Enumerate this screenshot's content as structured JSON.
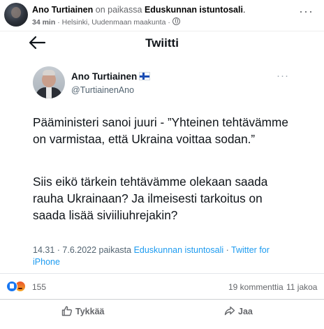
{
  "post": {
    "author": "Ano Turtiainen",
    "connector": "on paikassa",
    "place": "Eduskunnan istuntosali",
    "period": ".",
    "time": "34 min",
    "dot": "·",
    "location": "Helsinki, Uudenmaan maakunta",
    "dot2": "·",
    "more": "···"
  },
  "tweet": {
    "header_title": "Twiitti",
    "author_name": "Ano Turtiainen",
    "author_handle": "@TurtiainenAno",
    "more": "···",
    "paragraph1": "Pääministeri sanoi juuri - ”Yhteinen tehtävämme on varmistaa, että Ukraina voittaa sodan.”",
    "paragraph2": "Siis eikö tärkein tehtävämme olekaan saada rauha Ukrainaan? Ja ilmeisesti tarkoitus on saada lisää siviiliuhrejakin?",
    "meta_time": "14.31 · 7.6.2022 paikasta",
    "meta_place": "Eduskunnan istuntosali",
    "meta_sep": "·",
    "meta_client": "Twitter for iPhone"
  },
  "reactions": {
    "count": "155",
    "comments": "19 kommenttia",
    "shares": "11 jakoa"
  },
  "actions": {
    "like_label": "Tykkää",
    "share_label": "Jaa"
  },
  "colors": {
    "facebook_blue": "#1877f2",
    "twitter_link": "#1d9bf0",
    "muted_text": "#65676b"
  },
  "icons": {
    "back": "arrow-left-icon",
    "flag": "finland-flag-icon",
    "globe": "globe-icon",
    "like": "thumbs-up-icon",
    "share": "share-arrow-icon"
  }
}
